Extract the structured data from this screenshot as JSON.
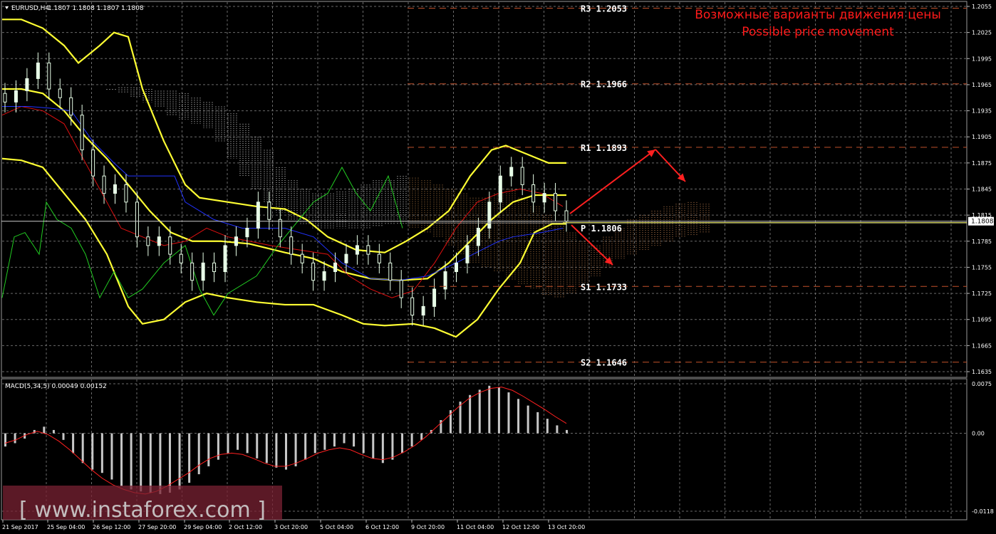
{
  "header": {
    "symbol_label": "EURUSD,H4",
    "ohlc_text": "1.1807 1.1808 1.1807 1.1808"
  },
  "annotation": {
    "line_ru": "Возможные варианты движения цены",
    "line_en": "Possible price movement"
  },
  "price_axis": {
    "ticks": [
      "1.2055",
      "1.2025",
      "1.1995",
      "1.1965",
      "1.1935",
      "1.1905",
      "1.1875",
      "1.1845",
      "1.1815",
      "1.1785",
      "1.1755",
      "1.1725",
      "1.1695",
      "1.1665",
      "1.1635"
    ],
    "tick_values": [
      1.2055,
      1.2025,
      1.1995,
      1.1965,
      1.1935,
      1.1905,
      1.1875,
      1.1845,
      1.1815,
      1.1785,
      1.1755,
      1.1725,
      1.1695,
      1.1665,
      1.1635
    ],
    "current_price_label": "1.1808",
    "current_price": 1.1808
  },
  "pivot_levels": [
    {
      "label": "R3  1.2053",
      "value": 1.2053
    },
    {
      "label": "R2  1.1966",
      "value": 1.1966
    },
    {
      "label": "R1  1.1893",
      "value": 1.1893
    },
    {
      "label": "P  1.1806",
      "value": 1.1806
    },
    {
      "label": "S1  1.1733",
      "value": 1.1733
    },
    {
      "label": "S2  1.1646",
      "value": 1.1646
    }
  ],
  "macd": {
    "label": "MACD(5,34,5) 0.00049 0.00152",
    "ticks": [
      "0.0075",
      "0.00",
      "-0.0118"
    ],
    "tick_values": [
      0.0075,
      0.0,
      -0.0118
    ]
  },
  "time_axis": {
    "labels": [
      "21 Sep 2017",
      "25 Sep 04:00",
      "26 Sep 12:00",
      "27 Sep 20:00",
      "29 Sep 04:00",
      "2 Oct 12:00",
      "3 Oct 20:00",
      "5 Oct 04:00",
      "6 Oct 12:00",
      "9 Oct 20:00",
      "11 Oct 04:00",
      "12 Oct 12:00",
      "13 Oct 20:00"
    ]
  },
  "watermark": {
    "text": "[ www.instaforex.com ]"
  },
  "colors": {
    "background": "#000000",
    "grid": "#6a6a6a",
    "pivot_line": "#c0502a",
    "pivot_label": "#ffffff",
    "annotation": "#ff1a1a",
    "arrow": "#ff2020",
    "bollinger": "#ffff33",
    "candle": "#e8ffe8",
    "fast_ma": "#e01010",
    "ichimoku_kijun": "#2233ff",
    "chikou": "#22cc22",
    "macd_hist": "#c8c8c8",
    "macd_signal": "#ff2020",
    "watermark_bg": "#7a2233"
  },
  "chart_data": {
    "type": "candlestick",
    "symbol": "EURUSD",
    "timeframe": "H4",
    "current_price": 1.1808,
    "pivots": {
      "R3": 1.2053,
      "R2": 1.1966,
      "R1": 1.1893,
      "P": 1.1806,
      "S1": 1.1733,
      "S2": 1.1646
    },
    "candles_close": [
      1.1945,
      1.1958,
      1.1972,
      1.199,
      1.196,
      1.195,
      1.193,
      1.189,
      1.186,
      1.184,
      1.185,
      1.183,
      1.179,
      1.178,
      1.179,
      1.177,
      1.176,
      1.174,
      1.176,
      1.175,
      1.178,
      1.179,
      1.18,
      1.183,
      1.181,
      1.179,
      1.177,
      1.176,
      1.174,
      1.175,
      1.176,
      1.177,
      1.178,
      1.177,
      1.176,
      1.174,
      1.172,
      1.17,
      1.171,
      1.173,
      1.175,
      1.176,
      1.178,
      1.18,
      1.183,
      1.186,
      1.187,
      1.185,
      1.183,
      1.184,
      1.182,
      1.1808
    ],
    "macd_histogram": [
      -0.002,
      -0.0015,
      -0.0008,
      0.0005,
      0.001,
      0.0005,
      -0.001,
      -0.003,
      -0.0045,
      -0.0055,
      -0.006,
      -0.007,
      -0.008,
      -0.0085,
      -0.0088,
      -0.009,
      -0.0092,
      -0.009,
      -0.0085,
      -0.0075,
      -0.0062,
      -0.005,
      -0.004,
      -0.003,
      -0.0025,
      -0.003,
      -0.0038,
      -0.0045,
      -0.0052,
      -0.0055,
      -0.005,
      -0.004,
      -0.003,
      -0.0025,
      -0.002,
      -0.0015,
      -0.002,
      -0.003,
      -0.0038,
      -0.0045,
      -0.004,
      -0.003,
      -0.002,
      -0.001,
      0.0005,
      0.002,
      0.0035,
      0.0048,
      0.0058,
      0.0066,
      0.0072,
      0.007,
      0.0062,
      0.0052,
      0.0042,
      0.0032,
      0.0022,
      0.0012,
      0.0005
    ],
    "macd_signal": [
      -0.0015,
      -0.001,
      -0.0002,
      0.0003,
      -0.0002,
      -0.0012,
      -0.0025,
      -0.004,
      -0.0055,
      -0.0068,
      -0.0078,
      -0.0085,
      -0.009,
      -0.0092,
      -0.0088,
      -0.008,
      -0.007,
      -0.006,
      -0.0048,
      -0.0038,
      -0.0032,
      -0.003,
      -0.0032,
      -0.0038,
      -0.0045,
      -0.005,
      -0.005,
      -0.0045,
      -0.0038,
      -0.003,
      -0.0025,
      -0.0022,
      -0.0025,
      -0.0032,
      -0.0038,
      -0.004,
      -0.0036,
      -0.0028,
      -0.0018,
      -0.0005,
      0.001,
      0.0025,
      0.004,
      0.0053,
      0.0062,
      0.0068,
      0.007,
      0.0065,
      0.0056,
      0.0046,
      0.0036,
      0.0025,
      0.0015
    ]
  }
}
